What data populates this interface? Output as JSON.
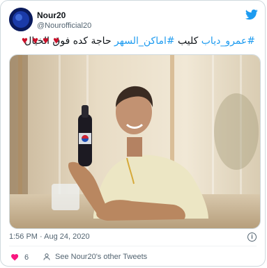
{
  "author": {
    "display_name": "Nour20",
    "handle": "@Nourofficial20"
  },
  "tweet": {
    "hashtag_1": "#عمرو_دياب",
    "word_1": " كليب ",
    "hashtag_2": "#اماكن_السهر",
    "word_2": " حاجة كده فوق الخيال ",
    "hearts": "♥ ♥ ♥ ♥"
  },
  "meta": {
    "timestamp": "1:56 PM · Aug 24, 2020"
  },
  "actions": {
    "like_count": "6",
    "other_tweets_label": "See Nour20's other Tweets"
  },
  "icons": {
    "brand": "twitter-bird-icon",
    "info": "info-icon",
    "like": "heart-icon",
    "profile": "person-icon"
  },
  "colors": {
    "accent": "#1d9bf0",
    "heart": "#c9102a",
    "muted": "#536471"
  }
}
